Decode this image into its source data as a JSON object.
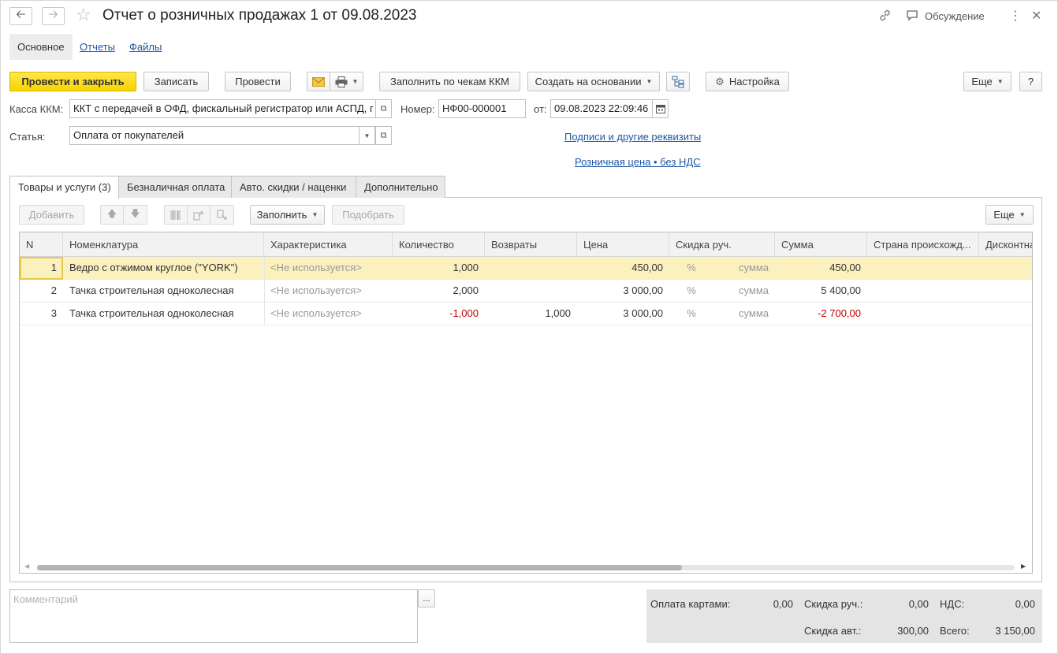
{
  "title": "Отчет о розничных продажах 1 от 09.08.2023",
  "header": {
    "discuss_label": "Обсуждение"
  },
  "sections": {
    "main": "Основное",
    "reports": "Отчеты",
    "files": "Файлы"
  },
  "toolbar": {
    "post_close": "Провести и закрыть",
    "save": "Записать",
    "post": "Провести",
    "fill_kkm": "Заполнить по чекам ККМ",
    "create_based": "Создать на основании",
    "settings": "Настройка",
    "more": "Еще",
    "help": "?"
  },
  "form": {
    "kkm_label": "Касса ККМ:",
    "kkm_value": "ККТ с передачей в ОФД, фискальный регистратор или АСПД, г",
    "number_label": "Номер:",
    "number_value": "НФ00-000001",
    "date_label": "от:",
    "date_value": "09.08.2023 22:09:46",
    "article_label": "Статья:",
    "article_value": "Оплата от покупателей",
    "link_signatures": "Подписи и другие реквизиты",
    "link_price": "Розничная цена • без НДС"
  },
  "tabs": [
    "Товары и услуги (3)",
    "Безналичная оплата",
    "Авто. скидки / наценки",
    "Дополнительно"
  ],
  "table_toolbar": {
    "add": "Добавить",
    "fill": "Заполнить",
    "pick": "Подобрать",
    "more": "Еще"
  },
  "table": {
    "headers": [
      "N",
      "Номенклатура",
      "Характеристика",
      "Количество",
      "Возвраты",
      "Цена",
      "Скидка руч.",
      "Сумма",
      "Страна происхожд...",
      "Дисконтна"
    ],
    "rows": [
      {
        "n": "1",
        "name": "Ведро с отжимом  круглое (\"YORK\")",
        "char": "<Не используется>",
        "qty": "1,000",
        "ret": "",
        "price": "450,00",
        "pct": "%",
        "dsum": "сумма",
        "sum": "450,00"
      },
      {
        "n": "2",
        "name": "Тачка строительная одноколесная",
        "char": "<Не используется>",
        "qty": "2,000",
        "ret": "",
        "price": "3 000,00",
        "pct": "%",
        "dsum": "сумма",
        "sum": "5 400,00"
      },
      {
        "n": "3",
        "name": "Тачка строительная одноколесная",
        "char": "<Не используется>",
        "qty": "-1,000",
        "ret": "1,000",
        "price": "3 000,00",
        "pct": "%",
        "dsum": "сумма",
        "sum": "-2 700,00"
      }
    ]
  },
  "footer": {
    "comment_placeholder": "Комментарий",
    "comment_btn": "...",
    "card_label": "Оплата картами:",
    "card_value": "0,00",
    "manual_disc_label": "Скидка руч.:",
    "manual_disc_value": "0,00",
    "vat_label": "НДС:",
    "vat_value": "0,00",
    "auto_disc_label": "Скидка авт.:",
    "auto_disc_value": "300,00",
    "total_label": "Всего:",
    "total_value": "3 150,00"
  },
  "colors": {
    "primary": "#f6d400",
    "link": "#1c57a3",
    "selected_row": "#fbf1be",
    "negative": "#c00000"
  },
  "icons": [
    "back-arrow-icon",
    "forward-arrow-icon",
    "star-icon",
    "link-icon",
    "discussion-icon",
    "more-vertical-icon",
    "close-icon",
    "email-icon",
    "print-icon",
    "structure-icon",
    "gear-icon",
    "calendar-icon",
    "open-icon",
    "arrow-up-icon",
    "arrow-down-icon",
    "barcode-icon"
  ]
}
